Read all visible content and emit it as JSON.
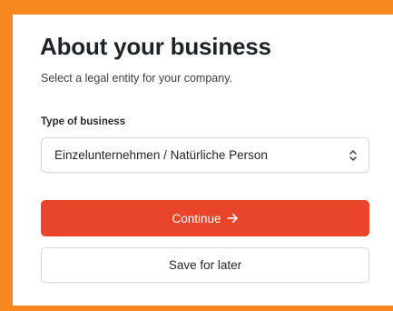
{
  "colors": {
    "frame_border": "#f7871f",
    "primary_button": "#e9452a",
    "text": "#1f2328"
  },
  "header": {
    "title": "About your business",
    "subtitle": "Select a legal entity for your company."
  },
  "form": {
    "business_type": {
      "label": "Type of business",
      "value": "Einzelunternehmen / Natürliche Person",
      "icon": "chevron-up-down-icon"
    }
  },
  "actions": {
    "continue_label": "Continue",
    "continue_icon": "arrow-right-icon",
    "save_label": "Save for later"
  }
}
